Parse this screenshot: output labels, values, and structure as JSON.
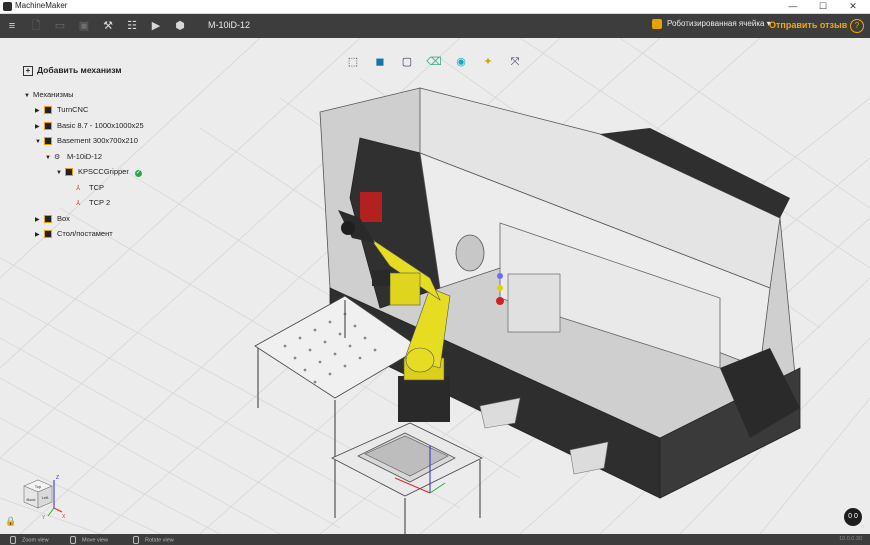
{
  "window": {
    "title": "MachineMaker",
    "minimize": "—",
    "maximize": "☐",
    "close": "✕"
  },
  "toolbar": {
    "document_title": "M-10iD-12",
    "cell_label": "Роботизированная ячейка",
    "cell_caret": "▾",
    "feedback_label": "Отправить отзыв",
    "help_label": "?",
    "buttons": [
      {
        "name": "menu-icon",
        "glyph": "≡"
      },
      {
        "name": "new-file-icon",
        "glyph": "🗋"
      },
      {
        "name": "open-folder-icon",
        "glyph": "▭"
      },
      {
        "name": "save-icon",
        "glyph": "▣"
      },
      {
        "name": "tools-icon",
        "glyph": "⚒"
      },
      {
        "name": "settings-sliders-icon",
        "glyph": "☷"
      },
      {
        "name": "play-icon",
        "glyph": "▶"
      },
      {
        "name": "export-cube-icon",
        "glyph": "⬢"
      }
    ]
  },
  "tree": {
    "add_mechanism": "Добавить механизм",
    "section": "Механизмы",
    "items": [
      {
        "label": "TurnCNC",
        "level": 1,
        "arrow": "▶",
        "kind": "node"
      },
      {
        "label": "Basic 8.7 - 1000x1000x25",
        "level": 1,
        "arrow": "▶",
        "kind": "node"
      },
      {
        "label": "Basement 300x700x210",
        "level": 1,
        "arrow": "▼",
        "kind": "node"
      },
      {
        "label": "M-10iD-12",
        "level": 2,
        "arrow": "▼",
        "kind": "robot"
      },
      {
        "label": "KPSCCGripper",
        "level": 3,
        "arrow": "▼",
        "kind": "node",
        "check": "✓"
      },
      {
        "label": "TCP",
        "level": 4,
        "arrow": "",
        "kind": "tcp"
      },
      {
        "label": "TCP 2",
        "level": 4,
        "arrow": "",
        "kind": "tcp"
      },
      {
        "label": "Box",
        "level": 1,
        "arrow": "▶",
        "kind": "node"
      },
      {
        "label": "Стол/постамент",
        "level": 1,
        "arrow": "▶",
        "kind": "node"
      }
    ]
  },
  "view_tools": [
    {
      "name": "view-wireframe-cube-icon",
      "glyph": "⬚"
    },
    {
      "name": "view-solid-cube-icon",
      "glyph": "◼"
    },
    {
      "name": "view-edges-cube-icon",
      "glyph": "▢"
    },
    {
      "name": "view-eraser-icon",
      "glyph": "⌫"
    },
    {
      "name": "view-globe-icon",
      "glyph": "◉"
    },
    {
      "name": "view-magic-icon",
      "glyph": "✦"
    },
    {
      "name": "view-fit-icon",
      "glyph": "⤧"
    }
  ],
  "navcube": {
    "top": "Top",
    "front": "Back",
    "side": "Left",
    "axis_x": "X",
    "axis_y": "Y",
    "axis_z": "Z"
  },
  "compass": "0 0",
  "statusbar": {
    "zoom": "Zoom view",
    "move": "Move view",
    "rotate": "Rotate view",
    "version": "10.0.0.30"
  },
  "colors": {
    "toolbar_bg": "#3d3d3d",
    "accent": "#f2a900",
    "robot_yellow": "#e8dc1e",
    "machine_dark": "#2f2f2f",
    "machine_light": "#e2e2e2"
  }
}
